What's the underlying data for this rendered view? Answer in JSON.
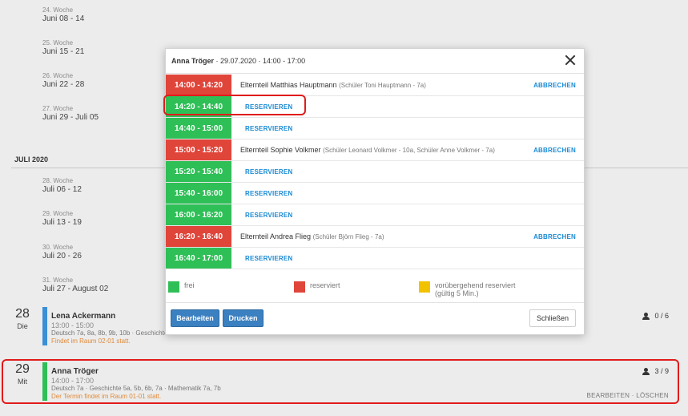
{
  "weeks_june": [
    {
      "week": "24. Woche",
      "range": "Juni 08 - 14"
    },
    {
      "week": "25. Woche",
      "range": "Juni 15 - 21"
    },
    {
      "week": "26. Woche",
      "range": "Juni 22 - 28"
    },
    {
      "week": "27. Woche",
      "range": "Juni 29 - Juli 05"
    }
  ],
  "month_heading": "JULI 2020",
  "weeks_july": [
    {
      "week": "28. Woche",
      "range": "Juli 06 - 12"
    },
    {
      "week": "29. Woche",
      "range": "Juli 13 - 19"
    },
    {
      "week": "30. Woche",
      "range": "Juli 20 - 26"
    },
    {
      "week": "31. Woche",
      "range": "Juli 27 - August 02"
    }
  ],
  "days": [
    {
      "num": "28",
      "name": "Die",
      "teacher": "Lena Ackermann",
      "time": "13:00 - 15:00",
      "subjects": "Deutsch 7a, 8a, 8b, 9b, 10b · Geschichte",
      "room": "Findet im Raum 02-01 statt.",
      "count": "0 / 6",
      "bar_color": "#3b8fd6"
    },
    {
      "num": "29",
      "name": "Mit",
      "teacher": "Anna Tröger",
      "time": "14:00 - 17:00",
      "subjects": "Deutsch 7a · Geschichte 5a, 5b, 6b, 7a · Mathematik 7a, 7b",
      "room": "Der Termin findet im Raum 01-01 statt.",
      "count": "3 / 9",
      "bar_color": "#2fbf57",
      "actions": "BEARBEITEN · LÖSCHEN"
    }
  ],
  "modal": {
    "teacher": "Anna Tröger",
    "rest": " · 29.07.2020 · 14:00 - 17:00",
    "reserve_label": "RESERVIEREN",
    "cancel_label": "ABBRECHEN",
    "slots": [
      {
        "time": "14:00 - 14:20",
        "status": "reserviert",
        "text": "Elternteil Matthias Hauptmann",
        "sub": "(Schüler Toni Hauptmann - 7a)"
      },
      {
        "time": "14:20 - 14:40",
        "status": "frei"
      },
      {
        "time": "14:40 - 15:00",
        "status": "frei"
      },
      {
        "time": "15:00 - 15:20",
        "status": "reserviert",
        "text": "Elternteil Sophie Volkmer",
        "sub": "(Schüler Leonard Volkmer - 10a, Schüler Anne Volkmer - 7a)"
      },
      {
        "time": "15:20 - 15:40",
        "status": "frei"
      },
      {
        "time": "15:40 - 16:00",
        "status": "frei"
      },
      {
        "time": "16:00 - 16:20",
        "status": "frei"
      },
      {
        "time": "16:20 - 16:40",
        "status": "reserviert",
        "text": "Elternteil Andrea Flieg",
        "sub": "(Schüler Björn Flieg - 7a)"
      },
      {
        "time": "16:40 - 17:00",
        "status": "frei"
      }
    ],
    "legend": {
      "free": "frei",
      "reserved": "reserviert",
      "temp_line1": "vorübergehend reserviert",
      "temp_line2": "(gültig 5 Min.)"
    },
    "buttons": {
      "edit": "Bearbeiten",
      "print": "Drucken",
      "close": "Schließen"
    }
  },
  "colors": {
    "free": "#2fbf57",
    "reserved": "#e0453a",
    "temporary": "#f2c200",
    "link": "#1a8ad4",
    "highlight": "#e11b1b"
  }
}
